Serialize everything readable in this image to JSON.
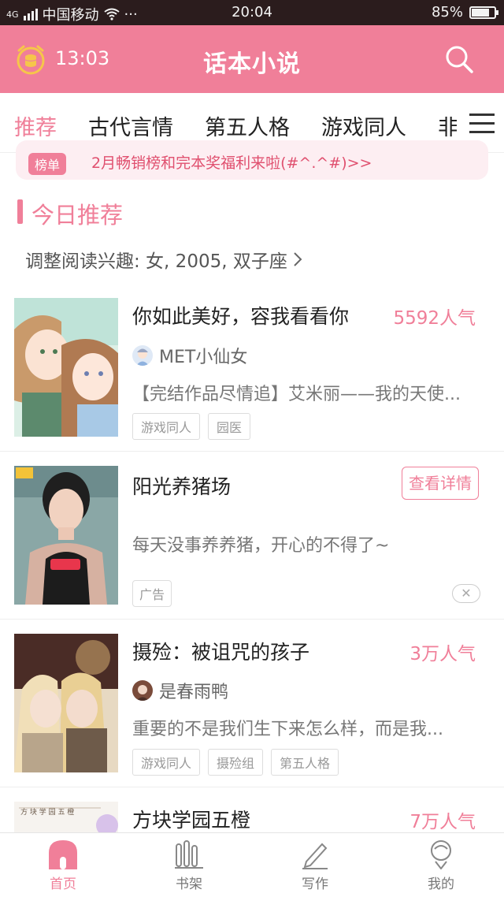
{
  "status_bar": {
    "network": "4G",
    "carrier": "中国移动",
    "more": "···",
    "time": "20:04",
    "battery": "85%",
    "battery_level": 0.85
  },
  "header": {
    "timer": "13:03",
    "title": "话本小说",
    "clock_icon": "alarm-clock-icon",
    "search_icon": "search-icon"
  },
  "tabs": {
    "items": [
      "推荐",
      "古代言情",
      "第五人格",
      "游戏同人",
      "非"
    ],
    "active_index": 0,
    "menu_icon": "menu-icon"
  },
  "banner": {
    "tag": "榜单",
    "text": "2月畅销榜和完本奖福利来啦(#^.^#)>>"
  },
  "section": {
    "title": "今日推荐",
    "interest": "调整阅读兴趣: 女, 2005, 双子座",
    "interest_chevron": "chevron-right-icon"
  },
  "items": [
    {
      "title": "你如此美好，容我看看你",
      "popularity": "5592人气",
      "author": "MET小仙女",
      "desc": "【完结作品尽情追】艾米丽——我的天使...",
      "tags": [
        "游戏同人",
        "园医"
      ]
    },
    {
      "title": "阳光养猪场",
      "button": "查看详情",
      "desc": "每天没事养养猪，开心的不得了~",
      "ad_label": "广告",
      "close": "✕"
    },
    {
      "title": "摄殓：被诅咒的孩子",
      "popularity": "3万人气",
      "author": "是春雨鸭",
      "desc": "重要的不是我们生下来怎么样，而是我...",
      "tags": [
        "游戏同人",
        "摄殓组",
        "第五人格"
      ]
    },
    {
      "title": "方块学园五橙",
      "popularity": "7万人气"
    }
  ],
  "bottom_nav": [
    {
      "label": "首页",
      "icon": "home-icon"
    },
    {
      "label": "书架",
      "icon": "bookshelf-icon"
    },
    {
      "label": "写作",
      "icon": "pencil-icon"
    },
    {
      "label": "我的",
      "icon": "profile-icon"
    }
  ],
  "colors": {
    "accent": "#f07f99",
    "status_bar": "#2b1c1d"
  }
}
